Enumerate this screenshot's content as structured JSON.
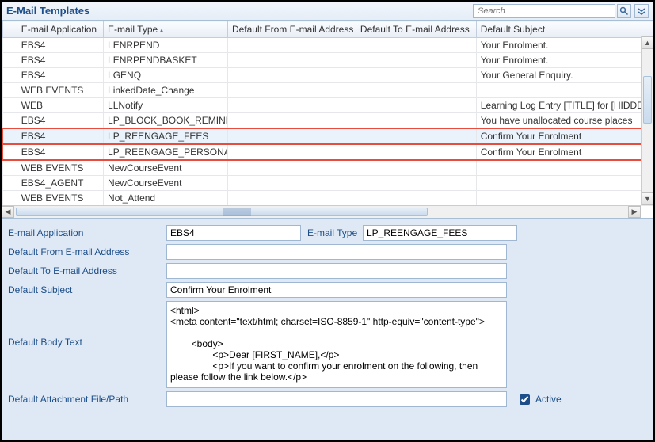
{
  "title": "E-Mail Templates",
  "search": {
    "placeholder": "Search"
  },
  "columns": [
    "E-mail Application",
    "E-mail Type",
    "Default From E-mail Address",
    "Default To E-mail Address",
    "Default Subject"
  ],
  "sorted_column_index": 1,
  "rows": [
    {
      "app": "EBS4",
      "type": "LENRPEND",
      "from": "",
      "to": "",
      "subject": "Your Enrolment."
    },
    {
      "app": "EBS4",
      "type": "LENRPENDBASKET",
      "from": "",
      "to": "",
      "subject": "Your Enrolment."
    },
    {
      "app": "EBS4",
      "type": "LGENQ",
      "from": "",
      "to": "",
      "subject": "Your General Enquiry."
    },
    {
      "app": "WEB EVENTS",
      "type": "LinkedDate_Change",
      "from": "",
      "to": "",
      "subject": ""
    },
    {
      "app": "WEB",
      "type": "LLNotify",
      "from": "",
      "to": "",
      "subject": "Learning Log Entry [TITLE] for [HIDDEN_L"
    },
    {
      "app": "EBS4",
      "type": "LP_BLOCK_BOOK_REMIND",
      "from": "",
      "to": "",
      "subject": "You have unallocated course places"
    },
    {
      "app": "EBS4",
      "type": "LP_REENGAGE_FEES",
      "from": "",
      "to": "",
      "subject": "Confirm Your Enrolment",
      "highlight": true,
      "selected": true
    },
    {
      "app": "EBS4",
      "type": "LP_REENGAGE_PERSONAL",
      "from": "",
      "to": "",
      "subject": "Confirm Your Enrolment",
      "highlight": true
    },
    {
      "app": "WEB EVENTS",
      "type": "NewCourseEvent",
      "from": "",
      "to": "",
      "subject": ""
    },
    {
      "app": "EBS4_AGENT",
      "type": "NewCourseEvent",
      "from": "",
      "to": "",
      "subject": ""
    },
    {
      "app": "WEB EVENTS",
      "type": "Not_Attend",
      "from": "",
      "to": "",
      "subject": ""
    }
  ],
  "form": {
    "label_email_application": "E-mail Application",
    "value_email_application": "EBS4",
    "label_email_type": "E-mail Type",
    "value_email_type": "LP_REENGAGE_FEES",
    "label_default_from": "Default From E-mail Address",
    "value_default_from": "",
    "label_default_to": "Default To E-mail Address",
    "value_default_to": "",
    "label_default_subject": "Default Subject",
    "value_default_subject": "Confirm Your Enrolment",
    "label_default_body": "Default Body Text",
    "value_default_body": "<html>\n<meta content=\"text/html; charset=ISO-8859-1\" http-equiv=\"content-type\">\n\n        <body>\n                <p>Dear [FIRST_NAME],</p>\n                <p>If you want to confirm your enrolment on the following, then please follow the link below.</p>",
    "label_attachment": "Default Attachment File/Path",
    "value_attachment": "",
    "label_active": "Active",
    "active_checked": true
  }
}
